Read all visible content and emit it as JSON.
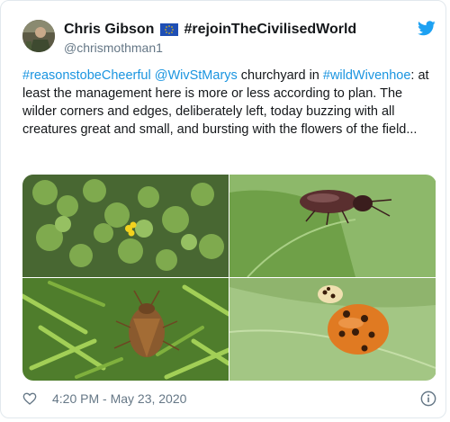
{
  "tweet": {
    "author": {
      "name": "Chris Gibson",
      "flag_icon": "eu-flag-icon",
      "name_suffix": "#rejoinTheCivilisedWorld",
      "handle": "@chrismothman1"
    },
    "body": {
      "hashtag_1": "#reasonstobeCheerful",
      "mention": "@WivStMarys",
      "text_1": " churchyard in ",
      "hashtag_2": "#wildWivenhoe",
      "text_2": ": at least the management here is more or less according to plan. The wilder corners and edges, deliberately left, today buzzing with all creatures great and small, and bursting with the flowers of the field..."
    },
    "media": [
      {
        "icon": "clover-flowers-photo"
      },
      {
        "icon": "beetle-on-leaf-photo"
      },
      {
        "icon": "shield-bug-photo"
      },
      {
        "icon": "ladybird-photo"
      }
    ],
    "timestamp": "4:20 PM - May 23, 2020",
    "icons": {
      "like": "heart-icon",
      "info": "info-icon",
      "brand": "twitter-bird-icon"
    },
    "colors": {
      "link": "#1b95e0",
      "text": "#14171a",
      "muted": "#657786",
      "brand": "#1da1f2"
    }
  }
}
